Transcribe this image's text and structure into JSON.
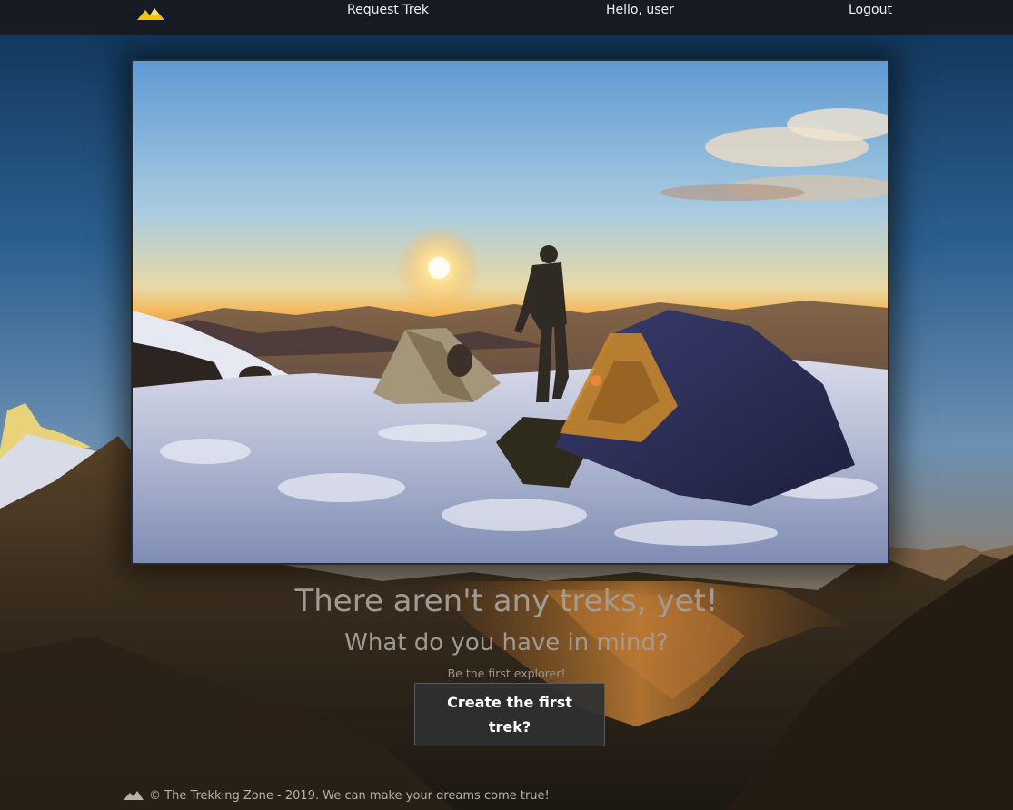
{
  "app": {
    "brand_icon": "mountain-logo-icon",
    "accent_color": "#f2c418"
  },
  "navbar": {
    "request_trek": "Request Trek",
    "greeting": "Hello, user",
    "logout": "Logout"
  },
  "hero": {
    "image": "photo-camp-tents-sunrise-mountain"
  },
  "empty_state": {
    "title": "There aren't any treks, yet!",
    "subtitle": "What do you have in mind?",
    "note": "Be the first explorer!",
    "cta_label": "Create the first trek?"
  },
  "footer": {
    "icon": "mountain-logo-icon",
    "text": "© The Trekking Zone - 2019. We can make your dreams come true!"
  }
}
